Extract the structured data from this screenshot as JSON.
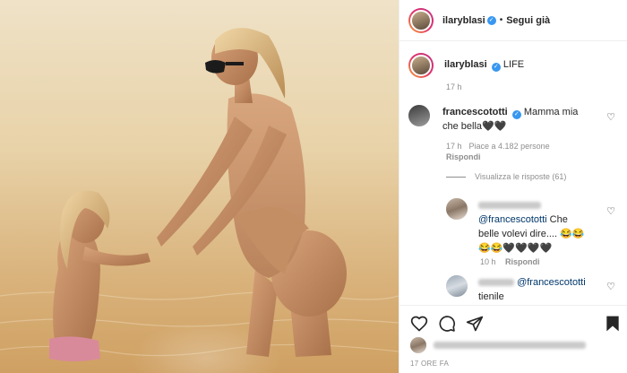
{
  "post": {
    "author": "ilaryblasi",
    "header_follow": "Segui già",
    "header_dot": "•",
    "verified_mark": "✓"
  },
  "caption": {
    "username": "ilaryblasi",
    "text": "LIFE",
    "time": "17 h"
  },
  "comments": [
    {
      "username": "francescototti",
      "text": "Mamma mia che bella",
      "emoji": "🖤🖤",
      "time": "17 h",
      "likes": "Piace a 4.182 persone",
      "reply_label": "Rispondi"
    }
  ],
  "view_replies": "Visualizza le risposte (61)",
  "replies": [
    {
      "mention": "@francescototti",
      "text": "Che belle volevi dire....",
      "emoji": "😂😂😂😂🖤🖤🖤🖤",
      "time": "10 h",
      "reply_label": "Rispondi"
    },
    {
      "mention": "@francescototti",
      "text": "tienile"
    }
  ],
  "footer": {
    "time": "17 ORE FA"
  },
  "icons": {
    "like": "heart-icon",
    "comment": "comment-icon",
    "share": "share-icon",
    "save": "bookmark-icon"
  },
  "colors": {
    "verified": "#3897f0",
    "mention": "#00376b",
    "muted": "#8e8e8e"
  }
}
